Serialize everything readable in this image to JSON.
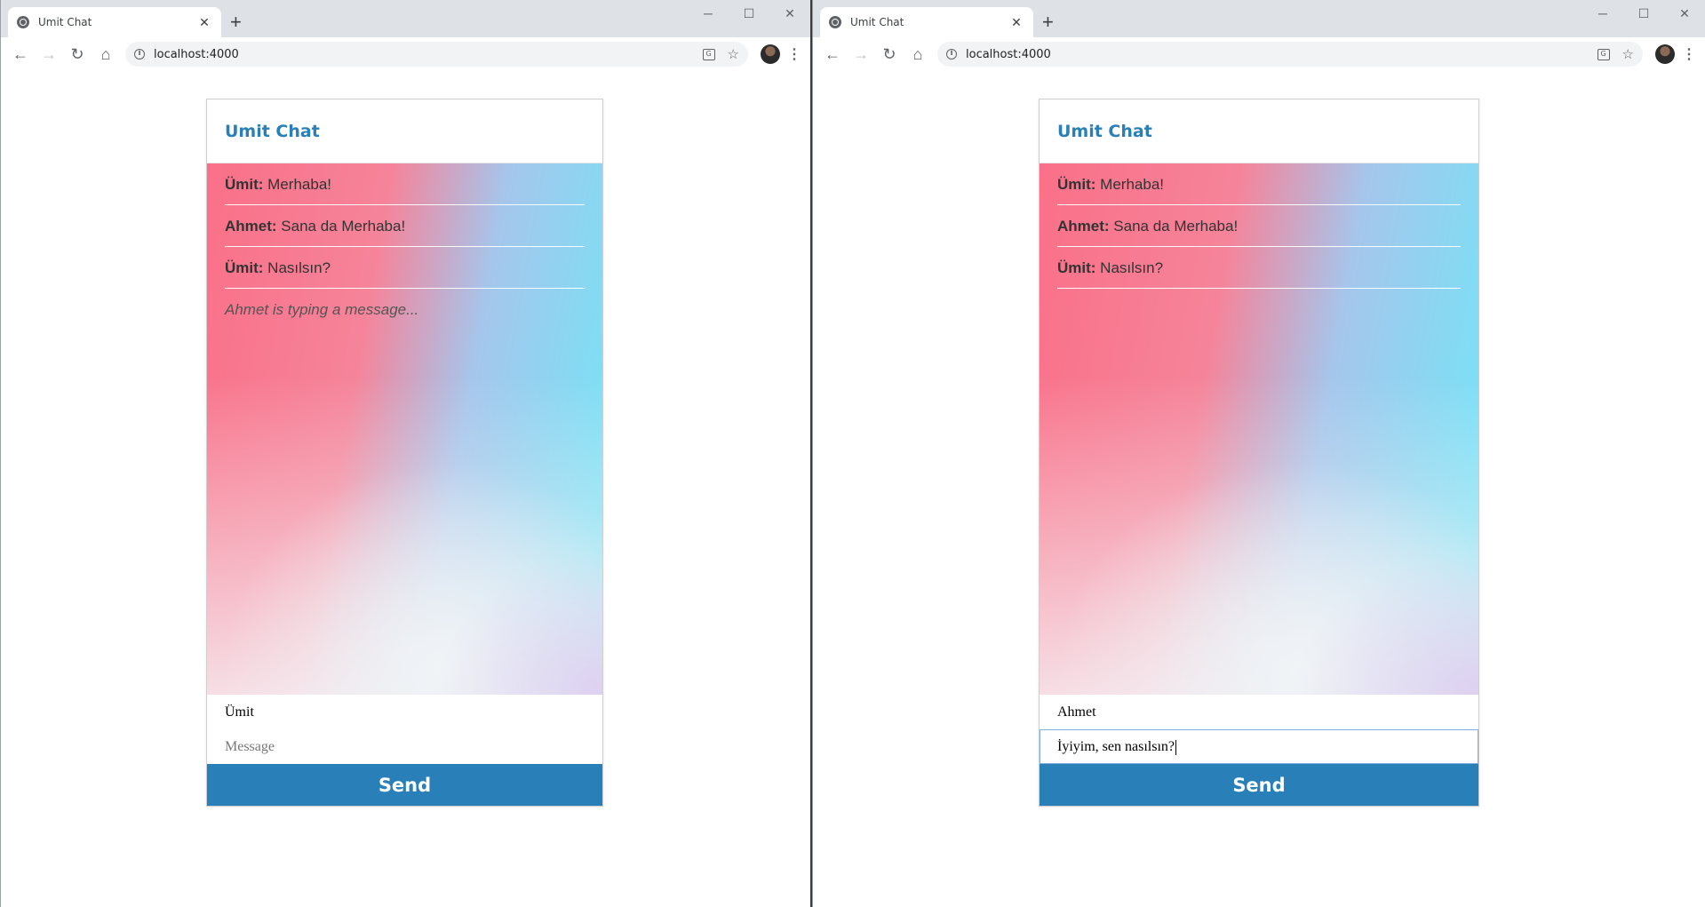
{
  "windows": [
    {
      "tab_title": "Umit Chat",
      "url": "localhost:4000",
      "chat": {
        "title": "Umit Chat",
        "messages": [
          {
            "sender": "Ümit:",
            "text": " Merhaba!"
          },
          {
            "sender": "Ahmet:",
            "text": " Sana da Merhaba!"
          },
          {
            "sender": "Ümit:",
            "text": " Nasılsın?"
          }
        ],
        "feedback": "Ahmet is typing a message...",
        "handle_value": "Ümit",
        "message_value": "",
        "message_placeholder": "Message",
        "send_label": "Send"
      }
    },
    {
      "tab_title": "Umit Chat",
      "url": "localhost:4000",
      "chat": {
        "title": "Umit Chat",
        "messages": [
          {
            "sender": "Ümit:",
            "text": " Merhaba!"
          },
          {
            "sender": "Ahmet:",
            "text": " Sana da Merhaba!"
          },
          {
            "sender": "Ümit:",
            "text": " Nasılsın?"
          }
        ],
        "handle_value": "Ahmet",
        "message_value": "İyiyim, sen nasılsın?",
        "message_placeholder": "Message",
        "send_label": "Send"
      }
    }
  ],
  "icons": {
    "back": "arrow-left-icon",
    "forward": "arrow-right-icon",
    "reload": "reload-icon",
    "home": "home-icon",
    "info": "info-icon",
    "translate": "translate-icon",
    "bookmark": "star-icon",
    "menu": "kebab-menu-icon"
  },
  "colors": {
    "accent": "#2980b9",
    "gradient_pink": "#fa7088",
    "gradient_cyan": "#6ee8f8"
  }
}
